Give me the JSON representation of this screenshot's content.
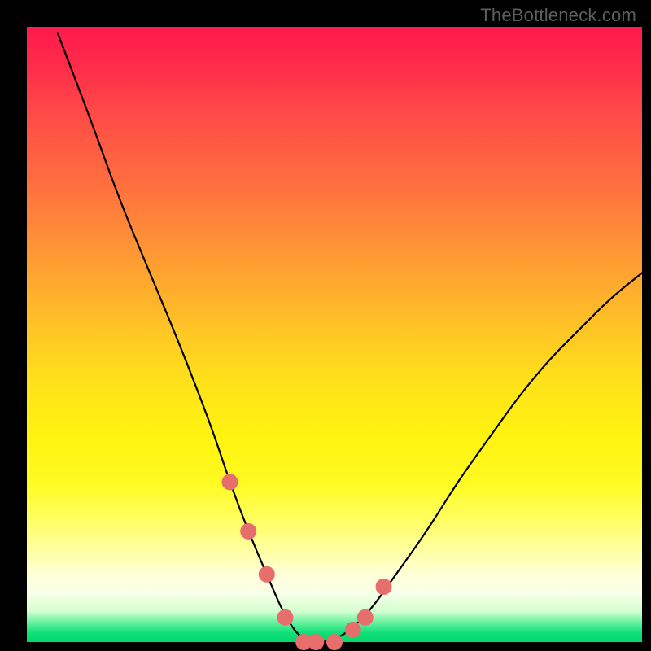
{
  "watermark": "TheBottleneck.com",
  "chart_data": {
    "type": "line",
    "title": "",
    "xlabel": "",
    "ylabel": "",
    "xlim": [
      0,
      100
    ],
    "ylim": [
      0,
      100
    ],
    "series": [
      {
        "name": "bottleneck-curve",
        "x": [
          5,
          10,
          15,
          20,
          25,
          30,
          33,
          36,
          39,
          42,
          45,
          50,
          55,
          60,
          65,
          70,
          75,
          80,
          85,
          90,
          95,
          100
        ],
        "values": [
          99,
          86,
          72,
          60,
          48,
          35,
          26,
          18,
          11,
          4,
          0,
          0,
          4,
          11,
          18,
          26,
          33,
          40,
          46,
          51,
          56,
          60
        ]
      }
    ],
    "markers": {
      "name": "highlighted-points",
      "color": "#e86d6d",
      "x": [
        33,
        36,
        39,
        42,
        45,
        47,
        50,
        53,
        55,
        58
      ],
      "values": [
        26,
        18,
        11,
        4,
        0,
        0,
        0,
        2,
        4,
        9
      ]
    },
    "gradient_bands": [
      {
        "color": "#ff1a4d",
        "stop_pct": 0
      },
      {
        "color": "#ff8a38",
        "stop_pct": 33
      },
      {
        "color": "#ffe21a",
        "stop_pct": 58
      },
      {
        "color": "#ffffd8",
        "stop_pct": 89
      },
      {
        "color": "#00d868",
        "stop_pct": 100
      }
    ]
  }
}
